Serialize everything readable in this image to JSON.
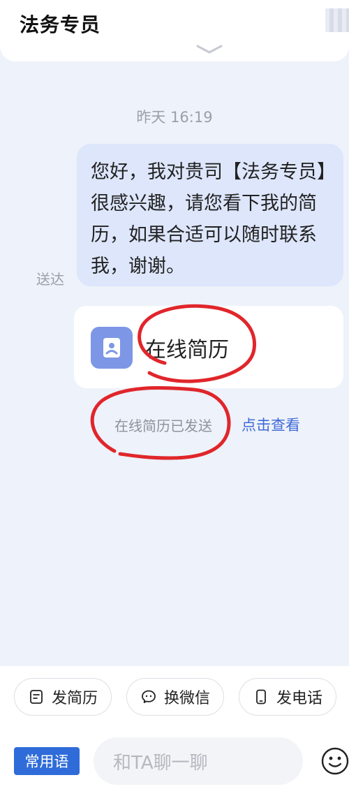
{
  "header": {
    "title": "法务专员"
  },
  "chat": {
    "timestamp": "昨天 16:19",
    "message": "您好，我对贵司【法务专员】很感兴趣，请您看下我的简历，如果合适可以随时联系我，谢谢。",
    "delivered_status": "送达",
    "resume_card_label": "在线简历",
    "sent_note": "在线简历已发送",
    "view_link": "点击查看"
  },
  "actions": [
    {
      "label": "发简历",
      "icon": "resume-icon"
    },
    {
      "label": "换微信",
      "icon": "wechat-icon"
    },
    {
      "label": "发电话",
      "icon": "phone-icon"
    }
  ],
  "composer": {
    "quick_reply_label": "常用语",
    "placeholder": "和TA聊一聊",
    "emoji_icon": "emoji-icon"
  },
  "colors": {
    "accent": "#2f6cd9",
    "bubble": "#dde6fb",
    "background": "#eef2fa",
    "annotation": "#e0262b"
  }
}
